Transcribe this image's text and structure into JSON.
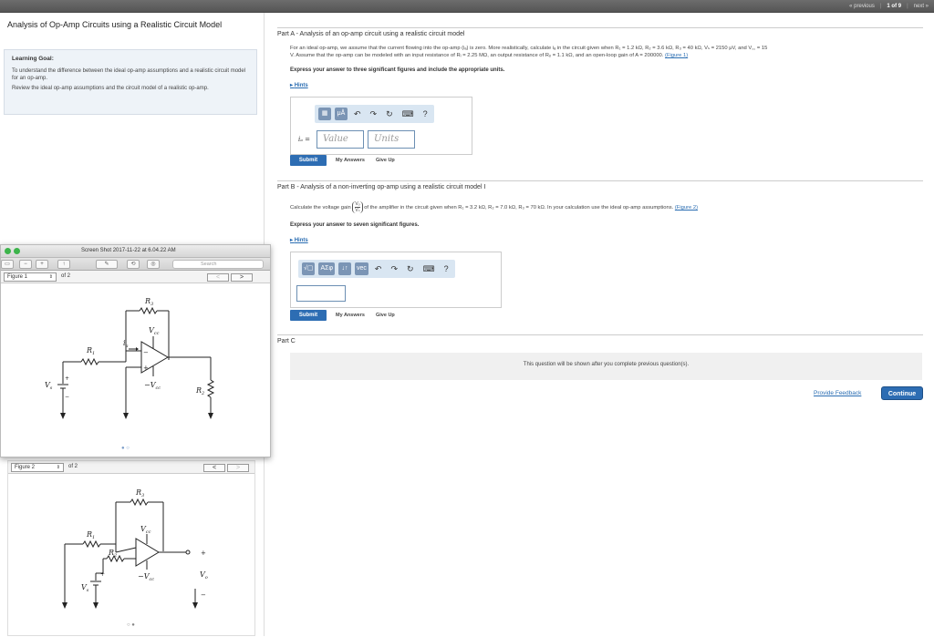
{
  "topnav": {
    "previous": "« previous",
    "position": "1 of 9",
    "next": "next »"
  },
  "left": {
    "title": "Analysis of Op-Amp Circuits using a Realistic Circuit Model",
    "goal_heading": "Learning Goal:",
    "goal_p1": "To understand the difference between the ideal op-amp assumptions and a realistic circuit model for an op-amp.",
    "goal_p2": "Review the ideal op-amp assumptions and the circuit model of a realistic op-amp."
  },
  "preview": {
    "title": "Screen Shot 2017-11-22 at 6.04.22 AM",
    "search_placeholder": "Search",
    "figure_label": "Figure 1",
    "of_label": "of 2",
    "prev": "<",
    "next": ">"
  },
  "figure1": {
    "R1": "R",
    "R1sub": "1",
    "R2": "R",
    "R2sub": "2",
    "R3": "R",
    "R3sub": "3",
    "ia": "i",
    "iasub": "a",
    "vcc": "V",
    "vccsub": "cc",
    "vee": "−V",
    "veesub": "cc",
    "vs": "V",
    "vssub": "s",
    "plus": "+",
    "minus": "−"
  },
  "figure2_panel": {
    "figure_label": "Figure 2",
    "of_label": "of 2",
    "prev": "<",
    "next": ">"
  },
  "figure2": {
    "R1": "R",
    "R1sub": "1",
    "R2": "R",
    "R2sub": "2",
    "R3": "R",
    "R3sub": "3",
    "vcc": "V",
    "vccsub": "cc",
    "vee": "−V",
    "veesub": "cc",
    "vs": "V",
    "vssub": "s",
    "vo": "V",
    "vosub": "o",
    "plus": "+",
    "minus": "−"
  },
  "partA": {
    "label": "Part A",
    "title": "Analysis of an op-amp circuit using a realistic circuit model",
    "text1": "For an ideal op-amp, we assume that the current flowing into the op-amp (iₐ) is zero. More realistically, calculate iₐ in the circuit given when R₁ = 1.2 kΩ, R₂ = 3.6 kΩ, R₃ = 40 kΩ, Vₛ = 2150 μV, and V꜀꜀ = 15",
    "text2": "V. Assume that the op-amp can be modeled with an input resistance of Rᵢ = 2.25 MΩ, an output resistance of Rₒ = 1.1 kΩ, and an open-loop gain of A = 200000.",
    "figure_link": "(Figure 1)",
    "instruction": "Express your answer to three significant figures and include the appropriate units.",
    "hints": "Hints",
    "var_label": "iₐ =",
    "value_placeholder": "Value",
    "units_placeholder": "Units",
    "submit": "Submit",
    "my_answers": "My Answers",
    "give_up": "Give Up"
  },
  "partB": {
    "label": "Part B",
    "title": "Analysis of a non-inverting op-amp using a realistic circuit model I",
    "text_pre": "Calculate the voltage gain",
    "gain_num": "Vₒ",
    "gain_den": "Vₛ",
    "text_post": "of the amplifier in the circuit given when R₁ = 3.2 kΩ, R₂ = 7.0 kΩ, R₃ = 70 kΩ. In your calculation use the ideal op-amp assumptions.",
    "figure_link": "(Figure 2)",
    "instruction": "Express your answer to seven significant figures.",
    "hints": "Hints",
    "submit": "Submit",
    "my_answers": "My Answers",
    "give_up": "Give Up"
  },
  "partC": {
    "label": "Part C",
    "message": "This question will be shown after you complete previous question(s)."
  },
  "footer": {
    "feedback": "Provide Feedback",
    "continue": "Continue"
  },
  "toolbarA": {
    "t1": "▦",
    "t2": "μÅ",
    "t3": "↶",
    "t4": "↷",
    "t5": "↻",
    "t6": "⌨",
    "t7": "?"
  },
  "toolbarB": {
    "t1": "√▢",
    "t2": "ΑΣφ",
    "t3": "↓↑",
    "t4": "vec",
    "t5": "↶",
    "t6": "↷",
    "t7": "↻",
    "t8": "⌨",
    "t9": "?"
  }
}
